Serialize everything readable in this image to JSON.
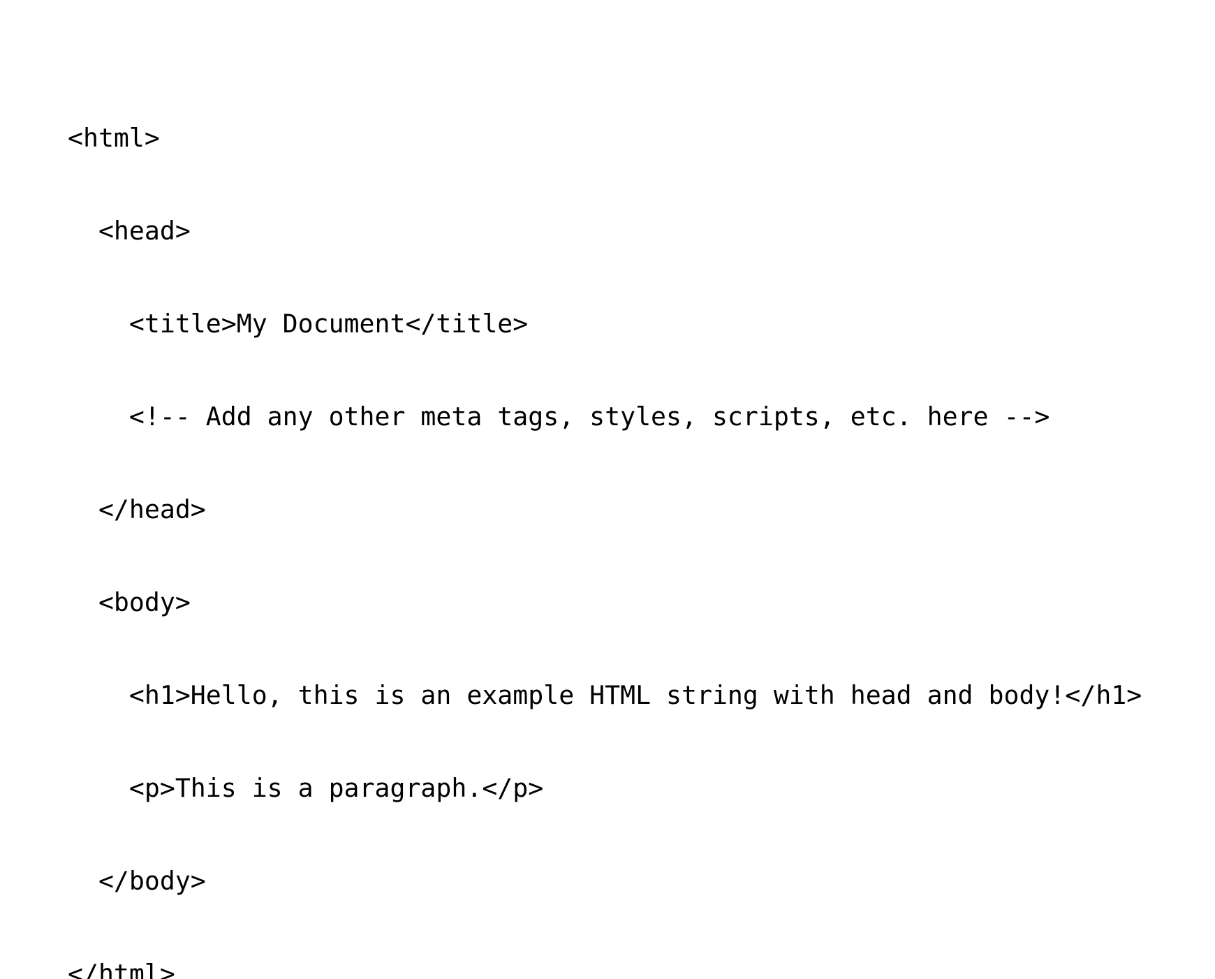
{
  "code_lines": [
    "<html>",
    "  <head>",
    "    <title>My Document</title>",
    "    <!-- Add any other meta tags, styles, scripts, etc. here -->",
    "  </head>",
    "  <body>",
    "    <h1>Hello, this is an example HTML string with head and body!</h1>",
    "    <p>This is a paragraph.</p>",
    "  </body>",
    "</html>"
  ]
}
